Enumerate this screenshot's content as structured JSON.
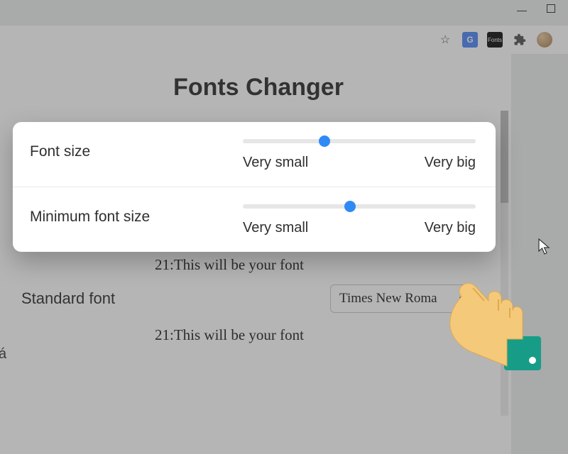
{
  "page": {
    "title": "Fonts Changer",
    "sample_text_1": "21:This will be your font",
    "sample_text_2": "21:This will be your font",
    "standard_font_label": "Standard font",
    "standard_font_value": "Times New Roma",
    "edge_letter": "á"
  },
  "modal": {
    "rows": [
      {
        "label": "Font size",
        "min_label": "Very small",
        "max_label": "Very big",
        "thumb_percent": 35
      },
      {
        "label": "Minimum font size",
        "min_label": "Very small",
        "max_label": "Very big",
        "thumb_percent": 46
      }
    ]
  },
  "toolbar": {
    "star": "☆",
    "translate": "G",
    "fonts": "Fonts"
  }
}
